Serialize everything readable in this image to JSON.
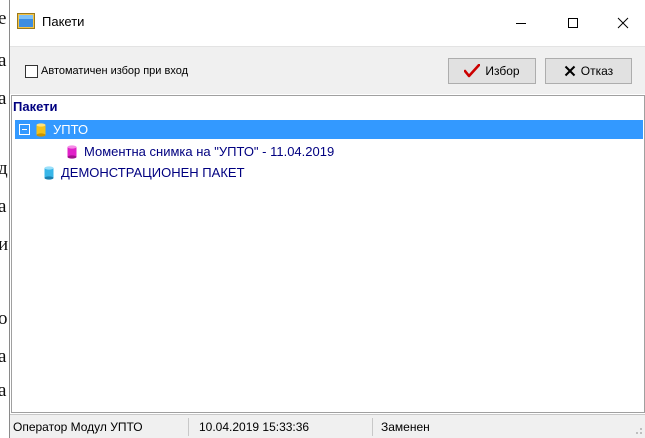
{
  "window": {
    "title": "Пакети"
  },
  "background_text": [
    "е",
    "а",
    "а",
    "д",
    "а",
    "и",
    "о",
    "а",
    "а"
  ],
  "toolbar": {
    "auto_select_label": "Автоматичен избор при вход",
    "auto_select_checked": false,
    "select_button": "Избор",
    "cancel_button": "Отказ"
  },
  "tree": {
    "header": "Пакети",
    "items": [
      {
        "label": "УПТО",
        "expanded": true,
        "selected": true,
        "icon": "database-yellow-icon"
      },
      {
        "label": "Моментна снимка на \"УПТО\" - 11.04.2019",
        "icon": "database-pink-icon"
      },
      {
        "label": "ДЕМОНСТРАЦИОНЕН ПАКЕТ",
        "icon": "database-cyan-icon"
      }
    ]
  },
  "statusbar": {
    "operator": "Оператор Модул УПТО",
    "datetime": "10.04.2019 15:33:36",
    "status": "Заменен"
  },
  "colors": {
    "selection": "#3399ff",
    "tree_text": "#000080",
    "check_accent": "#cc0000"
  }
}
